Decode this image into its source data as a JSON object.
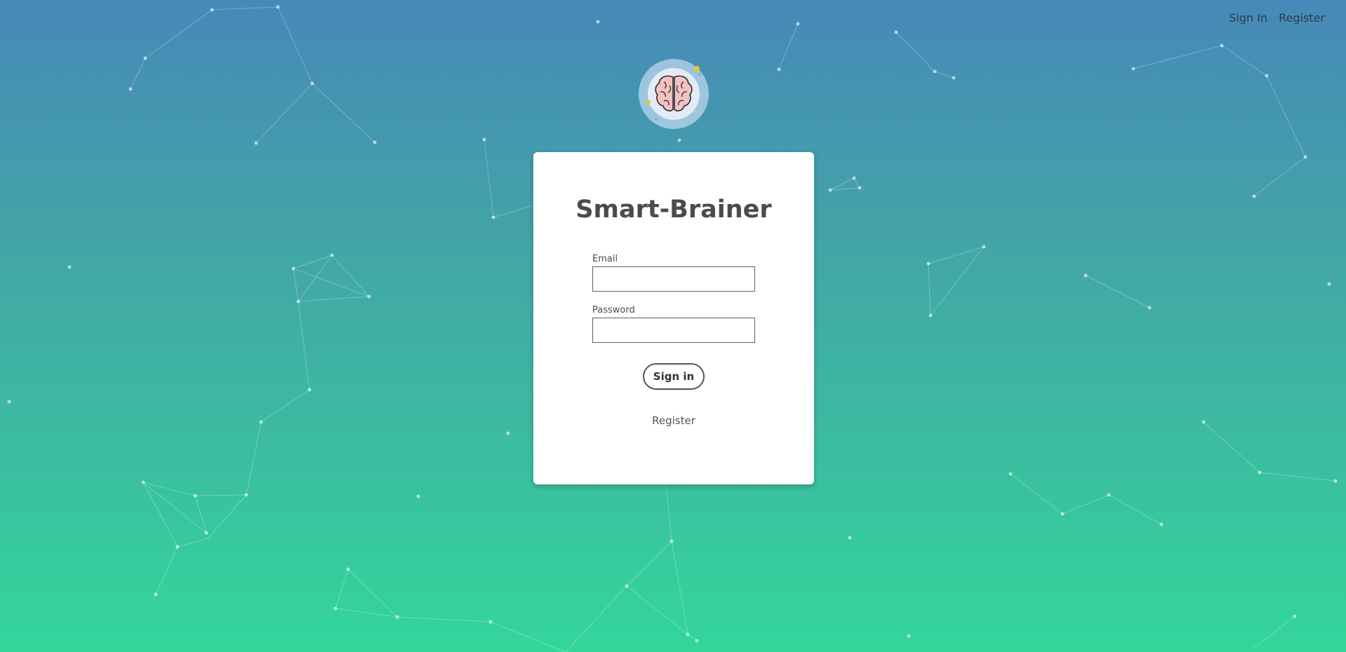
{
  "nav": {
    "sign_in_label": "Sign In",
    "register_label": "Register"
  },
  "logo": {
    "icon": "brain-icon"
  },
  "signin_form": {
    "title": "Smart-Brainer",
    "email_label": "Email",
    "email_value": "",
    "password_label": "Password",
    "password_value": "",
    "submit_label": "Sign in",
    "register_link": "Register"
  },
  "colors": {
    "gradient_top": "#4689b8",
    "gradient_bottom": "#33d69b",
    "card_background": "#ffffff",
    "text": "#4b4b4b"
  }
}
